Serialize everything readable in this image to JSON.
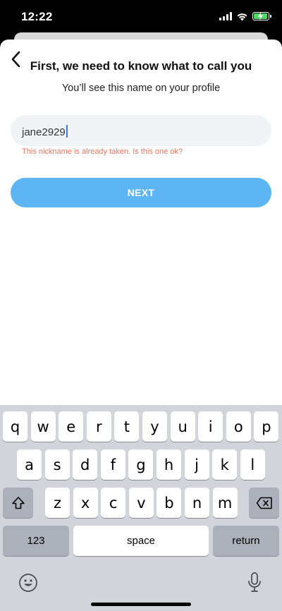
{
  "status_bar": {
    "time": "12:22",
    "icons": [
      "cellular-signal-icon",
      "wifi-icon",
      "battery-charging-icon"
    ]
  },
  "header": {
    "back_icon": "chevron-left-icon"
  },
  "form": {
    "title": "First, we need to know what to call you",
    "subtitle": "You’ll see this name on your profile",
    "nickname_value": "jane2929",
    "error_message": "This nickname is already taken. Is this one ok?",
    "next_label": "NEXT"
  },
  "colors": {
    "accent": "#5db5f4",
    "error": "#f0735b",
    "field_bg": "#f1f4f7",
    "keyboard_bg": "#d1d4da"
  },
  "keyboard": {
    "row1": [
      "q",
      "w",
      "e",
      "r",
      "t",
      "y",
      "u",
      "i",
      "o",
      "p"
    ],
    "row2": [
      "a",
      "s",
      "d",
      "f",
      "g",
      "h",
      "j",
      "k",
      "l"
    ],
    "row3": [
      "z",
      "x",
      "c",
      "v",
      "b",
      "n",
      "m"
    ],
    "numbers_label": "123",
    "space_label": "space",
    "return_label": "return",
    "icons": [
      "shift-icon",
      "backspace-icon",
      "emoji-icon",
      "microphone-icon"
    ]
  }
}
